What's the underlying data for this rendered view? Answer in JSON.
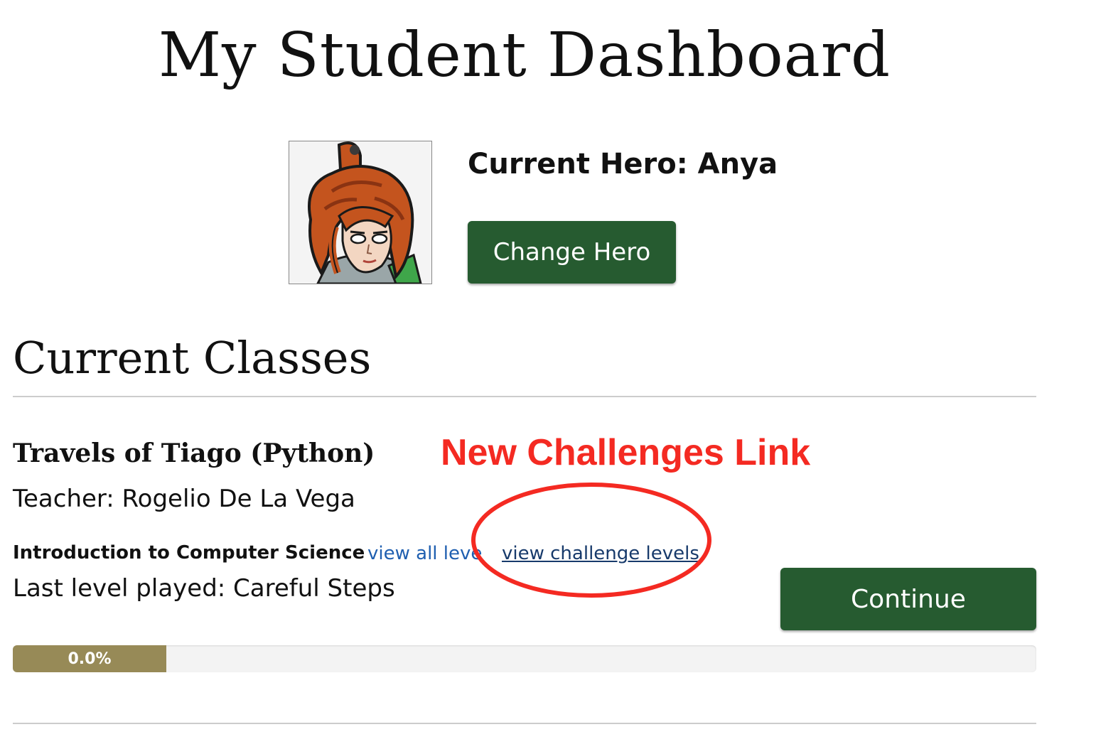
{
  "page": {
    "title": "My Student Dashboard"
  },
  "hero": {
    "label": "Current Hero: Anya",
    "change_button": "Change Hero",
    "portrait_icon": "hero-anya-portrait"
  },
  "classes": {
    "heading": "Current Classes",
    "items": [
      {
        "name": "Travels of Tiago (Python)",
        "teacher": "Teacher: Rogelio De La Vega",
        "course": "Introduction to Computer Science",
        "view_all_link": "view all levels",
        "view_challenge_link": "view challenge levels",
        "last_level": "Last level played: Careful Steps",
        "continue_button": "Continue",
        "progress": {
          "percent": 0.0,
          "label": "0.0%"
        }
      }
    ]
  },
  "annotation": {
    "text": "New Challenges Link",
    "color": "#f42a22"
  },
  "colors": {
    "button": "#265b30",
    "progress_fill": "#978a57",
    "link": "#1f5fb0"
  }
}
